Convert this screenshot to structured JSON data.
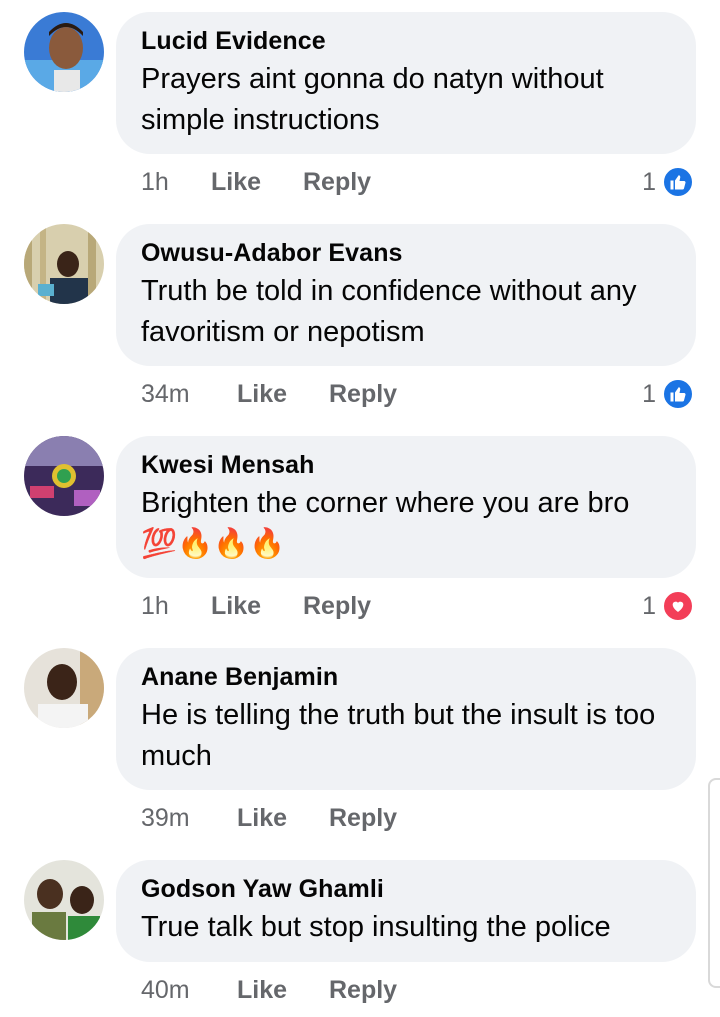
{
  "comments": [
    {
      "author": "Lucid Evidence",
      "text": "Prayers aint gonna do natyn without simple instructions",
      "time": "1h",
      "like_label": "Like",
      "reply_label": "Reply",
      "reaction_count": "1",
      "reaction_icon": "thumbs-up-icon",
      "avatar_color": "#2b6fcf"
    },
    {
      "author": "Owusu-Adabor Evans",
      "text": "Truth be told in confidence without any favoritism or nepotism",
      "time": "34m",
      "like_label": "Like",
      "reply_label": "Reply",
      "reaction_count": "1",
      "reaction_icon": "thumbs-up-icon",
      "avatar_color": "#c9b98a"
    },
    {
      "author": "Kwesi Mensah",
      "text": "Brighten the corner where you are bro 💯🔥🔥🔥",
      "time": "1h",
      "like_label": "Like",
      "reply_label": "Reply",
      "reaction_count": "1",
      "reaction_icon": "heart-icon",
      "avatar_color": "#7a3c8c"
    },
    {
      "author": "Anane Benjamin",
      "text": "He is telling the truth but the insult is too much",
      "time": "39m",
      "like_label": "Like",
      "reply_label": "Reply",
      "reaction_count": "",
      "reaction_icon": "",
      "avatar_color": "#3b2a20"
    },
    {
      "author": "Godson Yaw Ghamli",
      "text": "True talk but stop insulting the police",
      "time": "40m",
      "like_label": "Like",
      "reply_label": "Reply",
      "reaction_count": "",
      "reaction_icon": "",
      "avatar_color": "#6b7d3a"
    }
  ],
  "colors": {
    "bubble": "#f0f2f5",
    "meta_text": "#65676b",
    "like_blue": "#1b74e4",
    "love_red": "#f33e58"
  }
}
